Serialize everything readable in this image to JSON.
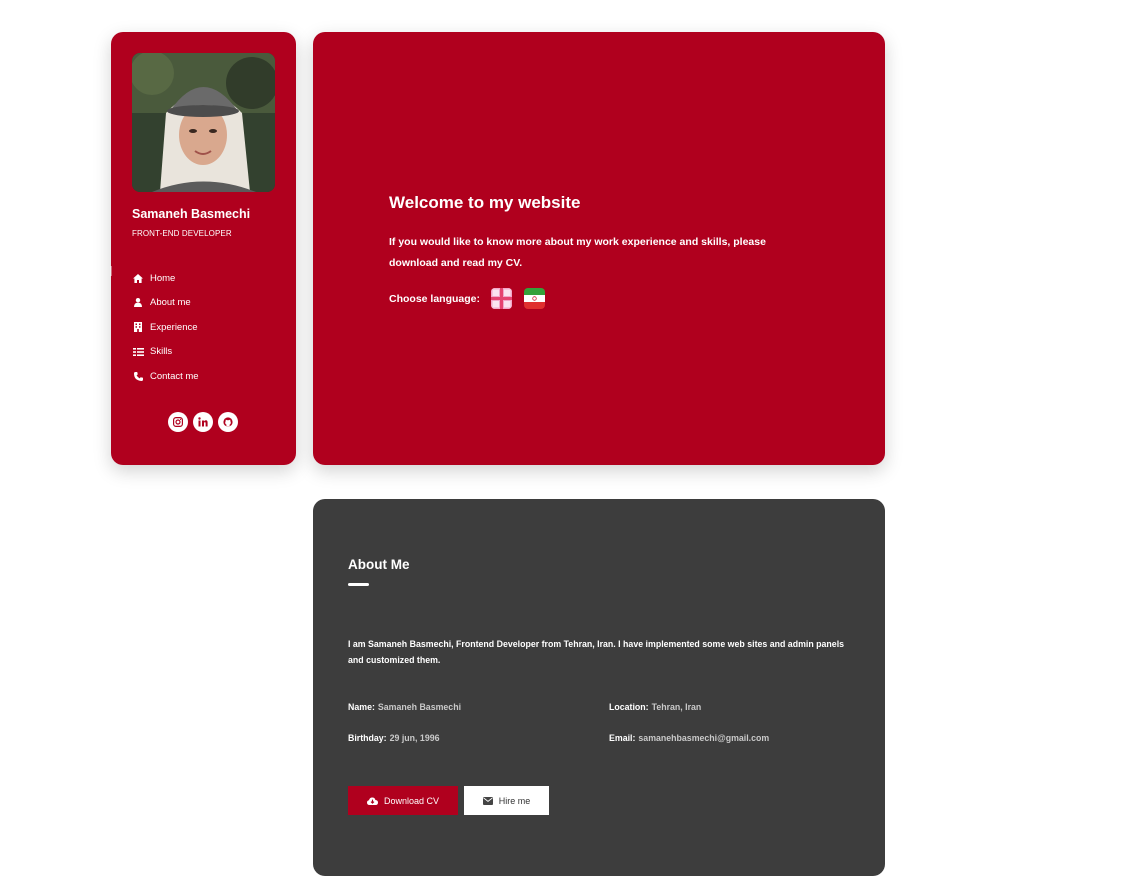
{
  "profile": {
    "name": "Samaneh Basmechi",
    "role": "FRONT-END DEVELOPER"
  },
  "nav": [
    {
      "label": "Home",
      "icon": "home-icon"
    },
    {
      "label": "About me",
      "icon": "user-icon"
    },
    {
      "label": "Experience",
      "icon": "building-icon"
    },
    {
      "label": "Skills",
      "icon": "list-icon"
    },
    {
      "label": "Contact me",
      "icon": "phone-icon"
    }
  ],
  "socials": [
    "instagram-icon",
    "linkedin-icon",
    "github-icon"
  ],
  "hero": {
    "title": "Welcome to my website",
    "text": "If you would like to know more about my work experience and skills, please download and read my CV.",
    "language_label": "Choose language:",
    "languages": [
      "english-flag-icon",
      "iran-flag-icon"
    ]
  },
  "about": {
    "title": "About Me",
    "bio": "I am Samaneh Basmechi, Frontend Developer from Tehran, Iran. I have implemented some web sites and admin panels and customized them.",
    "fields": {
      "name_label": "Name:",
      "name_value": "Samaneh Basmechi",
      "location_label": "Location:",
      "location_value": "Tehran, Iran",
      "birthday_label": "Birthday:",
      "birthday_value": "29 jun, 1996",
      "email_label": "Email:",
      "email_value": "samanehbasmechi@gmail.com"
    },
    "download_label": "Download CV",
    "hire_label": "Hire me"
  },
  "colors": {
    "accent": "#b0001e",
    "about_bg": "#3d3d3d"
  }
}
